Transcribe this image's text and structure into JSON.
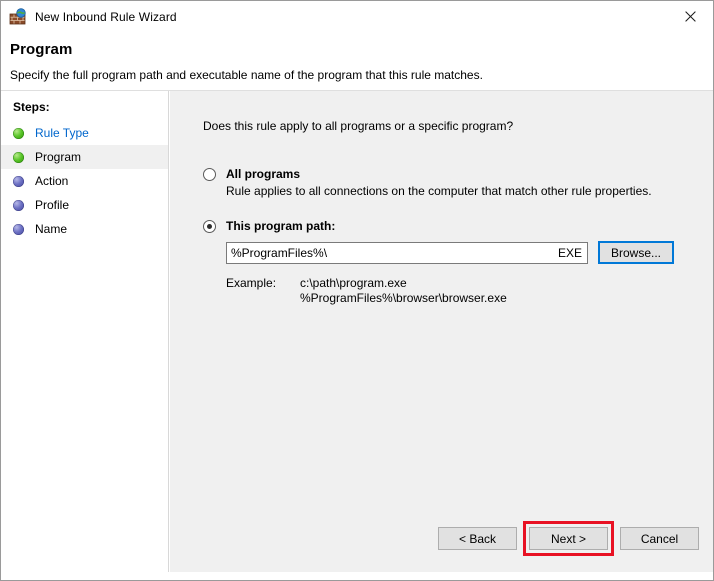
{
  "window": {
    "title": "New Inbound Rule Wizard",
    "icon": "firewall-brick-globe-icon",
    "close_label": "×"
  },
  "header": {
    "title": "Program",
    "subtitle": "Specify the full program path and executable name of the program that this rule matches."
  },
  "sidebar": {
    "heading": "Steps:",
    "items": [
      {
        "label": "Rule Type",
        "state": "completed",
        "bullet": "green",
        "link": true
      },
      {
        "label": "Program",
        "state": "current",
        "bullet": "green",
        "link": false
      },
      {
        "label": "Action",
        "state": "pending",
        "bullet": "blue",
        "link": false
      },
      {
        "label": "Profile",
        "state": "pending",
        "bullet": "blue",
        "link": false
      },
      {
        "label": "Name",
        "state": "pending",
        "bullet": "blue",
        "link": false
      }
    ]
  },
  "main": {
    "question": "Does this rule apply to all programs or a specific program?",
    "options": {
      "all_programs": {
        "label": "All programs",
        "description": "Rule applies to all connections on the computer that match other rule properties.",
        "selected": false
      },
      "program_path": {
        "label": "This program path:",
        "selected": true,
        "input_value": "%ProgramFiles%\\",
        "input_suffix": "EXE",
        "browse_label": "Browse..."
      }
    },
    "example": {
      "label": "Example:",
      "line1": "c:\\path\\program.exe",
      "line2": "%ProgramFiles%\\browser\\browser.exe"
    }
  },
  "footer": {
    "back_label": "< Back",
    "next_label": "Next >",
    "cancel_label": "Cancel"
  },
  "colors": {
    "accent_focus": "#0078d7",
    "annotation_red": "#e81123",
    "link_blue": "#0066cc",
    "panel_gray": "#f0f0f0",
    "button_face": "#e1e1e1"
  }
}
